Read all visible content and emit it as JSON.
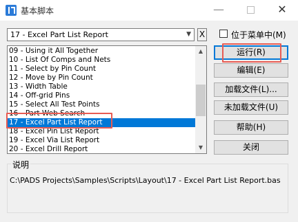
{
  "window": {
    "title": "基本脚本"
  },
  "titlebar": {
    "minimize": "—",
    "close": "✕"
  },
  "combo": {
    "selected": "17 - Excel Part List Report",
    "x_label": "X"
  },
  "list": {
    "items": [
      "09 - Using it All Together",
      "10 - List Of Comps and Nets",
      "11 - Select by Pin Count",
      "12 - Move by Pin Count",
      "13 - Width Table",
      "14 - Off-grid Pins",
      "15 - Select All Test Points",
      "16 - Part Web Search",
      "17 - Excel Part List Report",
      "18 - Excel Pin List Report",
      "19 - Excel Via List Report",
      "20 - Excel Drill Report"
    ],
    "selected_index": 8
  },
  "checkbox": {
    "label": "位于菜单中(M)",
    "checked": false
  },
  "buttons": {
    "run": "运行(R)",
    "edit": "编辑(E)",
    "load": "加载文件(L)...",
    "unload": "未加载文件(U)",
    "help": "帮助(H)",
    "close": "关闭"
  },
  "description": {
    "title": "说明",
    "path": "C:\\PADS Projects\\Samples\\Scripts\\Layout\\17 - Excel Part List Report.bas"
  }
}
